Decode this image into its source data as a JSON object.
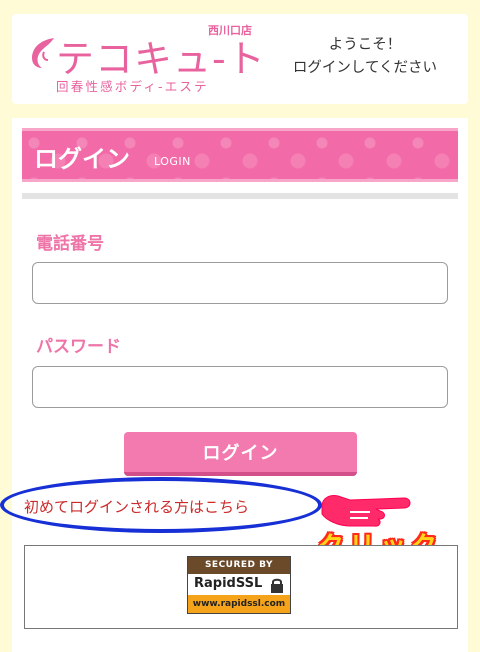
{
  "header": {
    "logo_main": "テコキュ-ト",
    "logo_branch": "西川口店",
    "logo_tagline": "回春性感ボディ-エステ",
    "welcome_line1": "ようこそ！",
    "welcome_line2": "ログインしてください"
  },
  "login": {
    "banner_title": "ログイン",
    "banner_subtitle": "LOGIN",
    "phone_label": "電話番号",
    "phone_value": "",
    "password_label": "パスワード",
    "password_value": "",
    "submit_label": "ログイン",
    "first_login_link": "初めてログインされる方はこちら"
  },
  "annotation": {
    "click_text": "クリック",
    "oval_color": "#1730d6",
    "pointer_icon": "pointing-hand-icon"
  },
  "ssl": {
    "top": "SECURED BY",
    "brand": "RapidSSL",
    "url": "www.rapidssl.com"
  },
  "colors": {
    "background": "#fffbd6",
    "accent_pink": "#f27aae",
    "link_red": "#cc2a2a"
  }
}
